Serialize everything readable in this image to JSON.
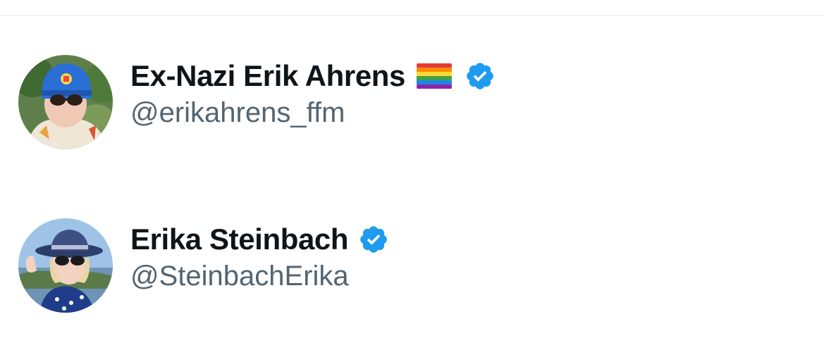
{
  "users": [
    {
      "display_name": "Ex-Nazi Erik Ahrens",
      "handle": "@erikahrens_ffm",
      "badge_emoji": "rainbow-flag-icon",
      "verified": true
    },
    {
      "display_name": "Erika Steinbach",
      "handle": "@SteinbachErika",
      "verified": true
    }
  ],
  "colors": {
    "name_text": "#0f1419",
    "handle_text": "#536471",
    "verified_blue": "#1d9bf0",
    "divider": "#eff3f4"
  }
}
